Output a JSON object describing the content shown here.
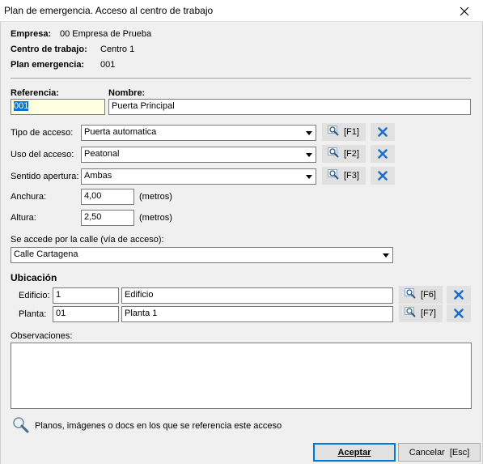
{
  "window": {
    "title": "Plan de emergencia. Acceso al centro de trabajo",
    "close_icon": "close-icon"
  },
  "header": {
    "empresa_label": "Empresa:",
    "empresa_value": "00 Empresa de Prueba",
    "centro_label": "Centro de trabajo:",
    "centro_value": "Centro 1",
    "plan_label": "Plan emergencia:",
    "plan_value": "001"
  },
  "form": {
    "referencia_label": "Referencia:",
    "referencia_value": "001",
    "nombre_label": "Nombre:",
    "nombre_value": "Puerta Principal",
    "tipo_label": "Tipo de acceso:",
    "tipo_value": "Puerta automatica",
    "tipo_key": "[F1]",
    "uso_label": "Uso del acceso:",
    "uso_value": "Peatonal",
    "uso_key": "[F2]",
    "sentido_label": "Sentido apertura:",
    "sentido_value": "Ambas",
    "sentido_key": "[F3]",
    "anchura_label": "Anchura:",
    "anchura_value": "4,00",
    "anchura_unit": "(metros)",
    "altura_label": "Altura:",
    "altura_value": "2,50",
    "altura_unit": "(metros)",
    "calle_label": "Se accede por la calle (vía de acceso):",
    "calle_value": "Calle Cartagena"
  },
  "ubicacion": {
    "title": "Ubicación",
    "edificio_label": "Edificio:",
    "edificio_code": "1",
    "edificio_name": "Edificio",
    "edificio_key": "[F6]",
    "planta_label": "Planta:",
    "planta_code": "01",
    "planta_name": "Planta 1",
    "planta_key": "[F7]"
  },
  "observaciones": {
    "label": "Observaciones:",
    "value": ""
  },
  "documents": {
    "text": "Planos, imágenes o docs en los que se referencia este acceso"
  },
  "footer": {
    "accept_label": "Aceptar",
    "cancel_label": "Cancelar  [Esc]"
  },
  "colors": {
    "accent": "#0078d7",
    "clear_icon": "#1e6fc7",
    "reference_bg": "#ffffe1"
  }
}
